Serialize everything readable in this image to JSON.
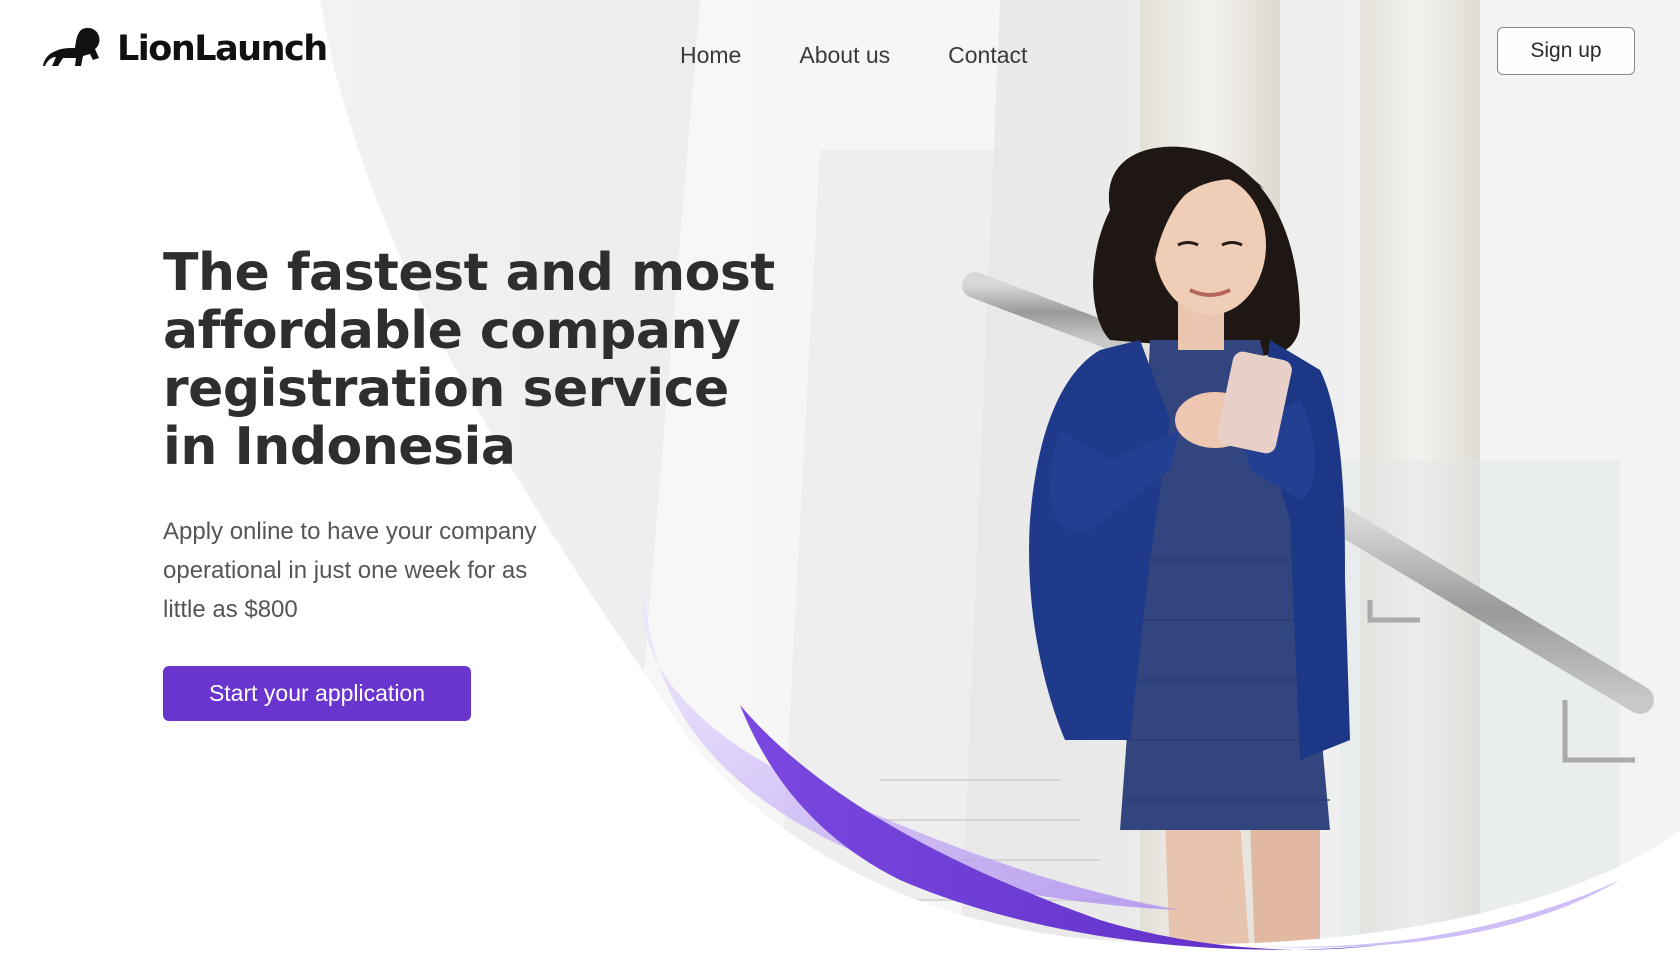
{
  "brand": {
    "name": "LionLaunch",
    "logo_icon": "lion-icon"
  },
  "nav": {
    "items": [
      "Home",
      "About us",
      "Contact"
    ]
  },
  "header": {
    "signup_label": "Sign up"
  },
  "hero": {
    "title_lines": [
      "The fastest and most",
      "affordable company",
      "registration service",
      "in Indonesia"
    ],
    "subtitle_lines": [
      "Apply online to have your company",
      "operational in just one week for as",
      "little as $800"
    ],
    "cta_label": "Start your application",
    "photo": "woman-on-stairs-with-phone"
  },
  "colors": {
    "accent": "#6a35cf",
    "accent_light": "#c9b5f5",
    "text_dark": "#2e2e2e",
    "text_body": "#555555",
    "blazer": "#1f3a8a"
  }
}
